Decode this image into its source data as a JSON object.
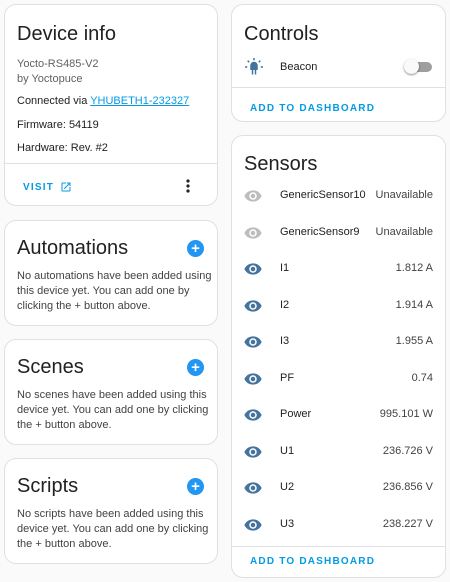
{
  "device_info": {
    "title": "Device info",
    "model": "Yocto-RS485-V2",
    "manufacturer": "by Yoctopuce",
    "connected_prefix": "Connected via ",
    "connected_link": "YHUBETH1-232327",
    "firmware": "Firmware: 54119",
    "hardware": "Hardware: Rev. #2",
    "visit_label": "VISIT"
  },
  "automations": {
    "title": "Automations",
    "empty_text": "No automations have been added using this device yet. You can add one by clicking the + button above."
  },
  "scenes": {
    "title": "Scenes",
    "empty_text": "No scenes have been added using this device yet. You can add one by clicking the + button above."
  },
  "scripts": {
    "title": "Scripts",
    "empty_text": "No scripts have been added using this device yet. You can add one by clicking the + button above."
  },
  "controls": {
    "title": "Controls",
    "items": [
      {
        "name": "Beacon",
        "state": "off"
      }
    ],
    "add_label": "ADD TO DASHBOARD"
  },
  "sensors": {
    "title": "Sensors",
    "items": [
      {
        "name": "GenericSensor10",
        "value": "Unavailable",
        "enabled": false
      },
      {
        "name": "GenericSensor9",
        "value": "Unavailable",
        "enabled": false
      },
      {
        "name": "I1",
        "value": "1.812 A",
        "enabled": true
      },
      {
        "name": "I2",
        "value": "1.914 A",
        "enabled": true
      },
      {
        "name": "I3",
        "value": "1.955 A",
        "enabled": true
      },
      {
        "name": "PF",
        "value": "0.74",
        "enabled": true
      },
      {
        "name": "Power",
        "value": "995.101 W",
        "enabled": true
      },
      {
        "name": "U1",
        "value": "236.726 V",
        "enabled": true
      },
      {
        "name": "U2",
        "value": "236.856 V",
        "enabled": true
      },
      {
        "name": "U3",
        "value": "238.227 V",
        "enabled": true
      }
    ],
    "add_label": "ADD TO DASHBOARD"
  },
  "colors": {
    "accent": "#039be5",
    "icon_enabled": "#44739e",
    "icon_disabled": "#bdbdbd",
    "plus_button": "#2196f3"
  }
}
